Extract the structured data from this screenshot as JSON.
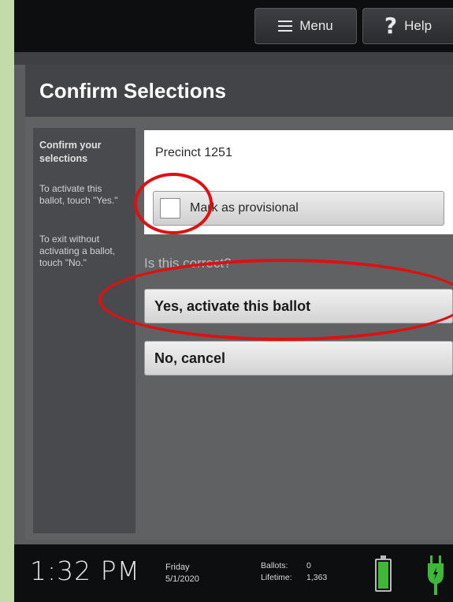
{
  "topbar": {
    "menu_label": "Menu",
    "help_label": "Help",
    "help_glyph": "?"
  },
  "header": {
    "title": "Confirm Selections"
  },
  "sidebar": {
    "heading": "Confirm your selections",
    "instruction_yes": "To activate this ballot, touch \"Yes.\"",
    "instruction_no": "To exit without activating a ballot, touch \"No.\""
  },
  "precinct": {
    "label": "Precinct 1251",
    "provisional_label": "Mark as provisional",
    "provisional_checked": false
  },
  "confirm": {
    "question": "Is this correct?",
    "yes_label": "Yes, activate this ballot",
    "no_label": "No, cancel"
  },
  "status": {
    "time": "1:32 PM",
    "weekday": "Friday",
    "date": "5/1/2020",
    "ballots_label": "Ballots:",
    "ballots_value": "0",
    "lifetime_label": "Lifetime:",
    "lifetime_value": "1,363",
    "battery_level": 1.0,
    "power_connected": true
  },
  "colors": {
    "annotation": "#e01010",
    "battery": "#3fb83a",
    "plug": "#3fb83a",
    "background": "#c3dba8"
  },
  "annotations": [
    "circle-provisional-checkbox",
    "circle-yes-button"
  ]
}
